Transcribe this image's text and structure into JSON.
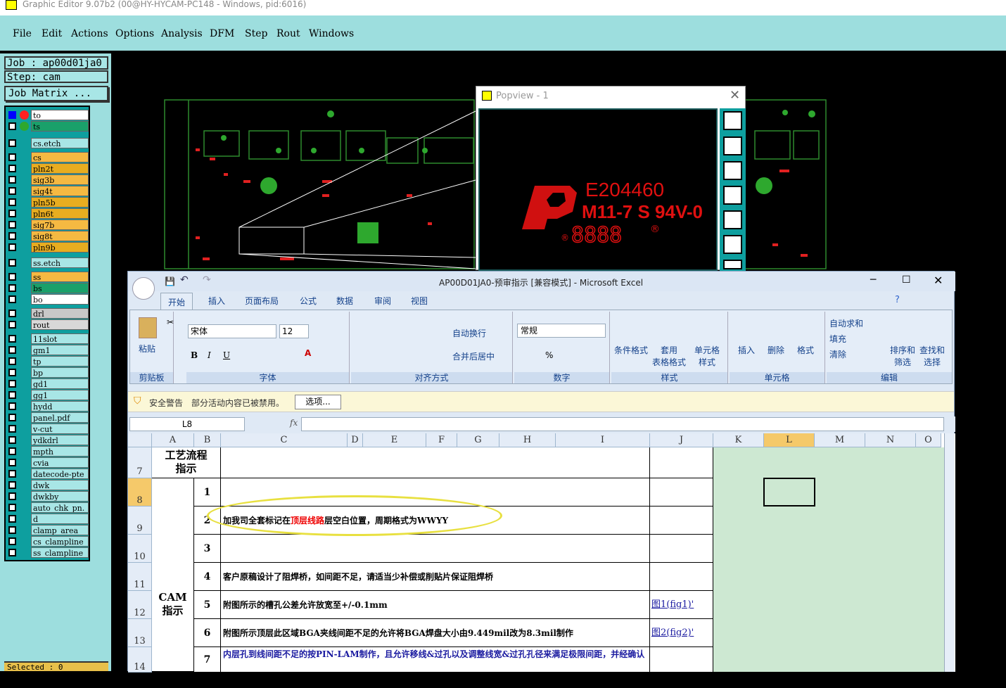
{
  "ge": {
    "title": "Graphic Editor 9.07b2 (00@HY-HYCAM-PC148 - Windows, pid:6016)",
    "menu": [
      "File",
      "Edit",
      "Actions",
      "Options",
      "Analysis",
      "DFM",
      "Step",
      "Rout",
      "Windows"
    ],
    "job": "Job : ap00d01ja0",
    "step": "Step: cam",
    "job_matrix": "Job Matrix ...",
    "selected": "Selected : 0",
    "layers": [
      {
        "name": "to",
        "color": "#ffffff",
        "dot": "#ff2020"
      },
      {
        "name": "ts",
        "color": "#1aa06a",
        "dot": "#2ea82e"
      },
      {
        "name": "cs.etch",
        "color": "#a8e6e6"
      },
      {
        "name": "cs",
        "color": "#f5b942"
      },
      {
        "name": "pln2t",
        "color": "#e8ad20"
      },
      {
        "name": "sig3b",
        "color": "#f5b942"
      },
      {
        "name": "sig4t",
        "color": "#f5b942"
      },
      {
        "name": "pln5b",
        "color": "#e8ad20"
      },
      {
        "name": "pln6t",
        "color": "#e8ad20"
      },
      {
        "name": "sig7b",
        "color": "#f5b942"
      },
      {
        "name": "sig8t",
        "color": "#f5b942"
      },
      {
        "name": "pln9b",
        "color": "#e8ad20"
      },
      {
        "name": "ss.etch",
        "color": "#a8e6e6"
      },
      {
        "name": "ss",
        "color": "#f5b942"
      },
      {
        "name": "bs",
        "color": "#1aa06a"
      },
      {
        "name": "bo",
        "color": "#ffffff"
      },
      {
        "name": "drl",
        "color": "#c8c8c8"
      },
      {
        "name": "rout",
        "color": "#d8d8d8"
      },
      {
        "name": "11slot",
        "color": "#a8e6e6"
      },
      {
        "name": "gm1",
        "color": "#a8e6e6"
      },
      {
        "name": "tp",
        "color": "#a8e6e6"
      },
      {
        "name": "bp",
        "color": "#a8e6e6"
      },
      {
        "name": "gd1",
        "color": "#a8e6e6"
      },
      {
        "name": "gg1",
        "color": "#a8e6e6"
      },
      {
        "name": "hydd",
        "color": "#a8e6e6"
      },
      {
        "name": "panel.pdf",
        "color": "#a8e6e6"
      },
      {
        "name": "v-cut",
        "color": "#a8e6e6"
      },
      {
        "name": "ydkdrl",
        "color": "#a8e6e6"
      },
      {
        "name": "mpth",
        "color": "#a8e6e6"
      },
      {
        "name": "cvia",
        "color": "#a8e6e6"
      },
      {
        "name": "datecode-pte",
        "color": "#a8e6e6"
      },
      {
        "name": "dwk",
        "color": "#a8e6e6"
      },
      {
        "name": "dwkby",
        "color": "#a8e6e6"
      },
      {
        "name": "auto_chk_pn.",
        "color": "#a8e6e6"
      },
      {
        "name": "d",
        "color": "#a8e6e6"
      },
      {
        "name": "clamp_area",
        "color": "#a8e6e6"
      },
      {
        "name": "cs_clampline",
        "color": "#a8e6e6"
      },
      {
        "name": "ss_clampline",
        "color": "#a8e6e6"
      }
    ]
  },
  "popview": {
    "title": "Popview - 1",
    "marking": {
      "line1": "E204460",
      "line2": "M11-7 S 94V-0",
      "line3": "8888"
    }
  },
  "excel": {
    "title": "AP00D01JA0-预审指示  [兼容模式] - Microsoft Excel",
    "tabs": [
      "开始",
      "插入",
      "页面布局",
      "公式",
      "数据",
      "审阅",
      "视图"
    ],
    "groups": {
      "clipboard": "剪贴板",
      "font": "字体",
      "align": "对齐方式",
      "number": "数字",
      "styles": "样式",
      "cells": "单元格",
      "edit": "编辑"
    },
    "paste": "粘贴",
    "font_name": "宋体",
    "font_size": "12",
    "wrap": "自动换行",
    "merge": "合并后居中",
    "numfmt": "常规",
    "cond": "条件格式",
    "table_fmt": "套用\n表格格式",
    "cell_style": "单元格\n样式",
    "insert": "插入",
    "delete": "删除",
    "format": "格式",
    "autosum": "自动求和",
    "fill": "填充",
    "clear": "清除",
    "sort": "排序和\n筛选",
    "find": "查找和\n选择",
    "security_label": "安全警告",
    "security_text": "部分活动内容已被禁用。",
    "options_btn": "选项...",
    "namebox": "L8",
    "fx": "fx",
    "cols": [
      "A",
      "B",
      "C",
      "D",
      "E",
      "F",
      "G",
      "H",
      "I",
      "J",
      "K",
      "L",
      "M",
      "N",
      "O"
    ],
    "rows": [
      "7",
      "8",
      "9",
      "10",
      "11",
      "12",
      "13",
      "14"
    ],
    "cells": {
      "a7": "工艺流程\n指示",
      "a_cam": "CAM\n指示",
      "b8": "1",
      "b9": "2",
      "b10": "3",
      "b11": "4",
      "b12": "5",
      "b13": "6",
      "b14": "7",
      "c9_pre": "加我司全套标记在",
      "c9_red": "顶层线路",
      "c9_post": "层空白位置，周期格式为WWYY",
      "c11": "客户原稿设计了阻焊桥，如间距不足，请适当少补偿或削贴片保证阻焊桥",
      "c12": "附图所示的槽孔公差允许放宽至+/-0.1mm",
      "c13": "附图所示顶层此区域BGA夹线间距不足的允许将BGA焊盘大小由9.449mil改为8.3mil制作",
      "c14": "内层孔到线间距不足的按PIN-LAM制作，且允许移线&过孔以及调整线宽&过孔孔径来满足极限间距，并经确认",
      "j12": "图1(fig1)'",
      "j13": "图2(fig2)'"
    }
  }
}
